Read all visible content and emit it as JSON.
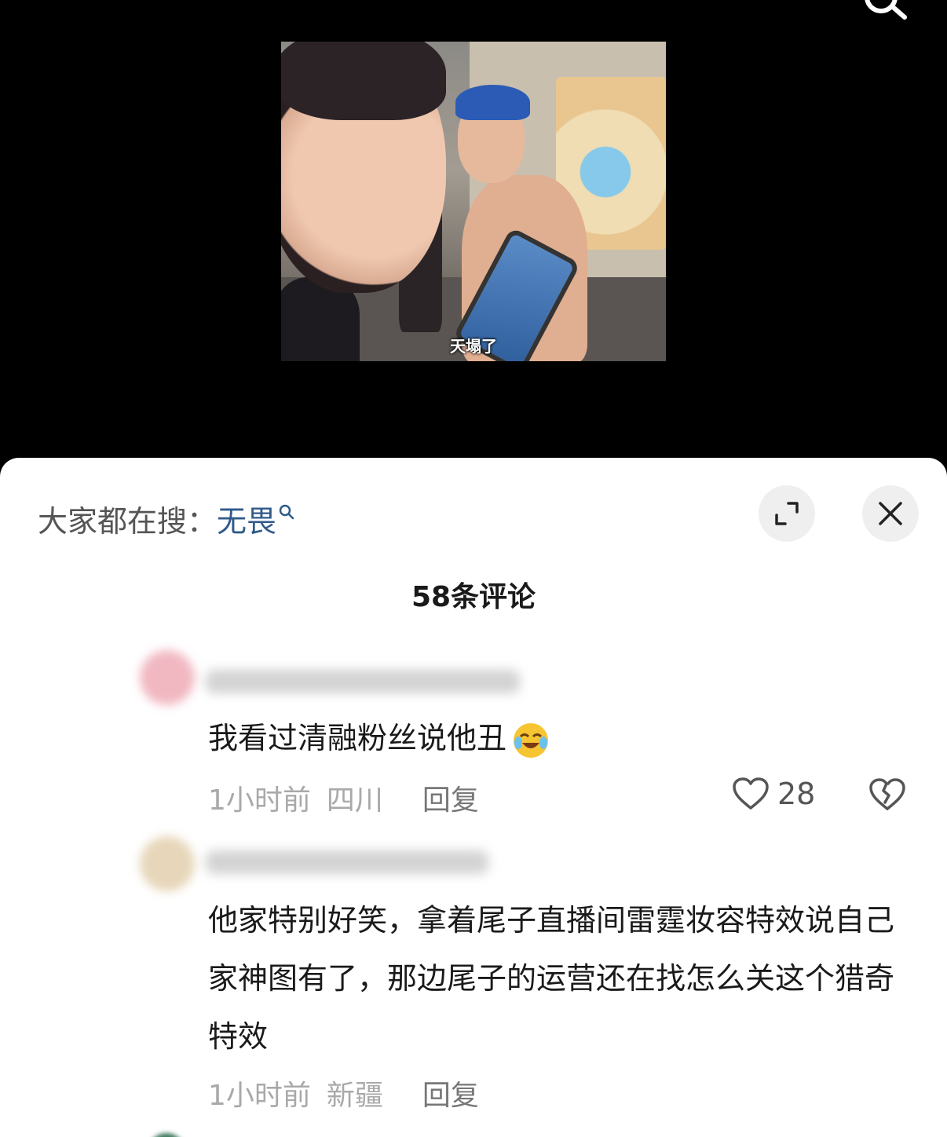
{
  "video": {
    "caption": "天塌了"
  },
  "comments_panel": {
    "hot_search_prefix": "大家都在搜：",
    "hot_search_keyword": "无畏",
    "title": "58条评论",
    "comments": [
      {
        "text": "我看过清融粉丝说他丑",
        "emoji": "crying-laughing",
        "time": "1小时前",
        "location": "四川",
        "reply_label": "回复",
        "likes": "28"
      },
      {
        "text": "他家特别好笑，拿着尾子直播间雷霆妆容特效说自己家神图有了，那边尾子的运营还在找怎么关这个猎奇特效",
        "time": "1小时前",
        "location": "新疆",
        "reply_label": "回复"
      }
    ]
  },
  "icons": {
    "top_search": "search-icon",
    "expand": "expand-icon",
    "close": "close-icon",
    "like": "heart-icon",
    "dislike": "broken-heart-icon"
  },
  "colors": {
    "keyword": "#2f5a8a",
    "meta_text": "#a9a9a9",
    "sheet_bg": "#ffffff",
    "page_bg": "#000000"
  }
}
